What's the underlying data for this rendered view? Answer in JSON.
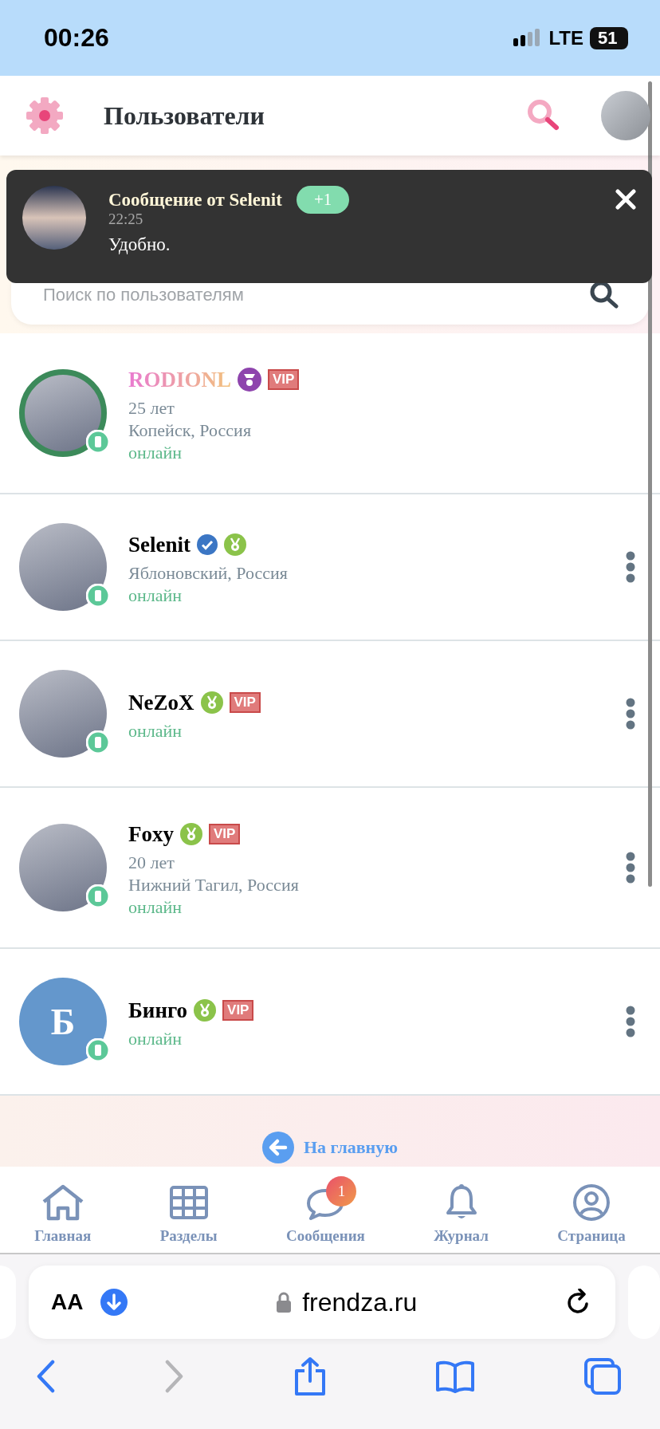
{
  "status_bar": {
    "time": "00:26",
    "network": "LTE",
    "battery": "51"
  },
  "header": {
    "title": "Пользователи"
  },
  "notification": {
    "title": "Сообщение от Selenit",
    "count": "+1",
    "time": "22:25",
    "text": "Удобно."
  },
  "search": {
    "placeholder": "Поиск по пользователям"
  },
  "users": [
    {
      "name": "RODIONL",
      "kind": "gradient",
      "avatar": {
        "kind": "photo",
        "ring": true
      },
      "badges": [
        {
          "kind": "crown-medal"
        },
        {
          "kind": "vip",
          "text": "VIP"
        }
      ],
      "age": "25 лет",
      "city": "Копейск, Россия",
      "status": "онлайн",
      "menu": false
    },
    {
      "name": "Selenit",
      "kind": "plain",
      "avatar": {
        "kind": "photo",
        "ring": false
      },
      "badges": [
        {
          "kind": "verified"
        },
        {
          "kind": "medal"
        }
      ],
      "city": "Яблоновский, Россия",
      "status": "онлайн",
      "menu": true
    },
    {
      "name": "NeZoX",
      "kind": "plain",
      "avatar": {
        "kind": "photo",
        "ring": false
      },
      "badges": [
        {
          "kind": "medal"
        },
        {
          "kind": "vip",
          "text": "VIP"
        }
      ],
      "status": "онлайн",
      "menu": true
    },
    {
      "name": "Foxy",
      "kind": "plain",
      "avatar": {
        "kind": "photo",
        "ring": false
      },
      "badges": [
        {
          "kind": "medal"
        },
        {
          "kind": "vip",
          "text": "VIP"
        }
      ],
      "age": "20 лет",
      "city": "Нижний Тагил, Россия",
      "status": "онлайн",
      "menu": true
    },
    {
      "name": "Бинго",
      "kind": "plain",
      "avatar": {
        "kind": "letter",
        "letter": "Б",
        "ring": false
      },
      "badges": [
        {
          "kind": "medal"
        },
        {
          "kind": "vip",
          "text": "VIP"
        }
      ],
      "status": "онлайн",
      "menu": true
    }
  ],
  "home_link": "На главную",
  "bottom_nav": [
    {
      "kind": "home",
      "label": "Главная"
    },
    {
      "kind": "grid",
      "label": "Разделы"
    },
    {
      "kind": "chat",
      "label": "Сообщения",
      "badge": "1"
    },
    {
      "kind": "bell",
      "label": "Журнал"
    },
    {
      "kind": "user",
      "label": "Страница"
    }
  ],
  "browser": {
    "text_size": "AA",
    "url": "frendza.ru"
  }
}
